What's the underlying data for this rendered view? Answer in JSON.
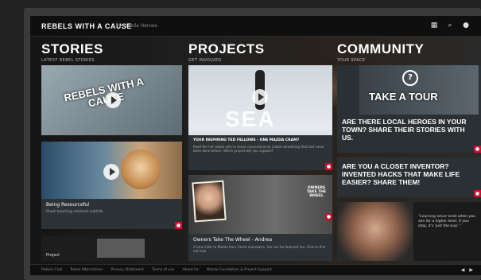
{
  "header": {
    "brand": "REBELS WITH A CAUSE",
    "brand_sub": "by Mazda Heroes",
    "icons": [
      "grid-icon",
      "search-icon",
      "user-icon"
    ]
  },
  "stories": {
    "title": "STORIES",
    "subtitle": "LATEST REBEL STORIES",
    "cards": [
      {
        "logo_text": "REBELS WITH A CAUSE"
      },
      {
        "caption": "Being Resourceful",
        "caption_sub": "Short teaching moment subtitle"
      },
      {
        "caption": "Project"
      }
    ]
  },
  "projects": {
    "title": "PROJECTS",
    "subtitle": "GET INVOLVED",
    "cards": [
      {
        "overlay_text": "SEA",
        "caption": "YOUR INSPIRING TED FELLOWS - ONE MAZDA CRAM?",
        "caption_sub": "Read the hot rebels who're brave conventions to create something that had never been done before. Which project will you support?"
      },
      {
        "caption": "Owners Take The Wheel - Andrea",
        "caption_sub": "A time killer to Mazda from Czech mountains. You can be featured too. Click to find out how",
        "logo_text": "OWNERS TAKE THE WHEEL"
      }
    ]
  },
  "community": {
    "title": "COMMUNITY",
    "subtitle": "YOUR SPACE",
    "cards": [
      {
        "overlay_text": "TAKE A TOUR",
        "tagline": "ARE THERE LOCAL HEROES IN YOUR TOWN? SHARE THEIR STORIES WITH US."
      },
      {
        "tagline": "ARE YOU A CLOSET INVENTOR? INVENTED HACKS THAT MAKE LIFE EASIER? SHARE THEM!"
      },
      {
        "quote": "“Learning never ends when you aim for a higher level. If you stop, it's 'just the way'.”"
      }
    ]
  },
  "footer": {
    "links": [
      "Rebels Club",
      "Rebel Alternatives",
      "Privacy Statement",
      "Terms of use",
      "About Us",
      "Mazda Foundation & Project Support"
    ],
    "controls": [
      "◀",
      "▶"
    ]
  },
  "colors": {
    "accent": "#c8102e",
    "card": "#2d3236",
    "bg": "#111111"
  }
}
